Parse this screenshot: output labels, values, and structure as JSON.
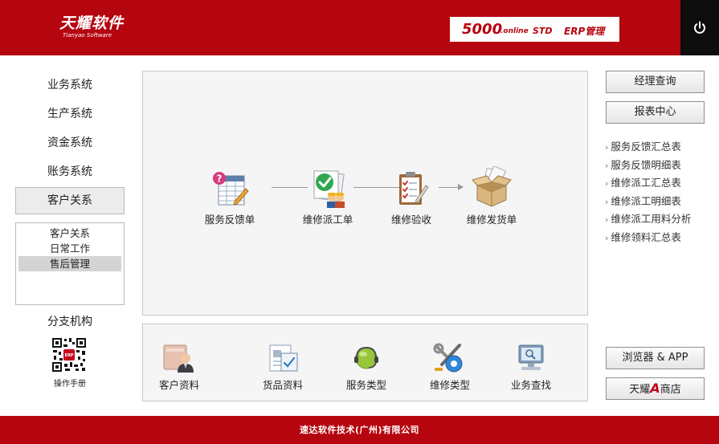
{
  "header": {
    "logo_cn": "天耀软件",
    "logo_en": "Tianyao Software",
    "version_num": "5000",
    "version_online": ".online",
    "version_std": "STD",
    "version_erp": "ERP管理"
  },
  "sidebar": {
    "items": [
      {
        "label": "业务系统"
      },
      {
        "label": "生产系统"
      },
      {
        "label": "资金系统"
      },
      {
        "label": "账务系统"
      },
      {
        "label": "客户关系"
      }
    ],
    "active_item": "客户关系",
    "sub_items": [
      {
        "label": "客户关系"
      },
      {
        "label": "日常工作"
      },
      {
        "label": "售后管理"
      }
    ],
    "selected_sub_item": "售后管理",
    "branch_label": "分支机构",
    "manual_label": "操作手册"
  },
  "flow": {
    "nodes": [
      {
        "label": "服务反馈单"
      },
      {
        "label": "维修派工单"
      },
      {
        "label": "维修验收"
      },
      {
        "label": "维修发货单"
      }
    ]
  },
  "tools": {
    "items": [
      {
        "label": "客户资料"
      },
      {
        "label": "货品资料"
      },
      {
        "label": "服务类型"
      },
      {
        "label": "维修类型"
      },
      {
        "label": "业务查找"
      }
    ]
  },
  "right": {
    "manager_query": "经理查询",
    "report_center": "报表中心",
    "report_links": [
      {
        "label": "服务反馈汇总表"
      },
      {
        "label": "服务反馈明细表"
      },
      {
        "label": "维修派工汇总表"
      },
      {
        "label": "维修派工明细表"
      },
      {
        "label": "维修派工用料分析"
      },
      {
        "label": "维修领料汇总表"
      }
    ],
    "browser_app": "浏览器 & APP",
    "shop_prefix": "天耀",
    "shop_letter": "A",
    "shop_suffix": "商店"
  },
  "footer": {
    "company": "速达软件技术(广州)有限公司"
  },
  "colors": {
    "brand_red": "#b5050f",
    "power_bg": "#0d0d0d",
    "panel_bg": "#f5f5f5"
  }
}
